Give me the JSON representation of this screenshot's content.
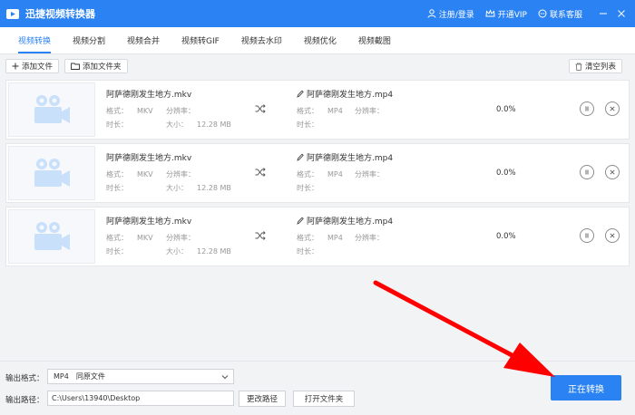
{
  "app": {
    "title": "迅捷视频转换器"
  },
  "header": {
    "login": "注册/登录",
    "vip": "开通VIP",
    "service": "联系客服"
  },
  "tabs": [
    "视频转换",
    "视频分割",
    "视频合并",
    "视频转GIF",
    "视频去水印",
    "视频优化",
    "视频截图"
  ],
  "toolbar": {
    "add_file": "添加文件",
    "add_folder": "添加文件夹",
    "clear": "清空列表"
  },
  "labels": {
    "format": "格式：",
    "resolution": "分辨率：",
    "duration": "时长：",
    "size": "大小："
  },
  "files": [
    {
      "src_name": "阿萨德刚发生地方.mkv",
      "src_format": "MKV",
      "src_size": "12.28 MB",
      "dst_name": "阿萨德刚发生地方.mp4",
      "dst_format": "MP4",
      "progress": "0.0%"
    },
    {
      "src_name": "阿萨德刚发生地方.mkv",
      "src_format": "MKV",
      "src_size": "12.28 MB",
      "dst_name": "阿萨德刚发生地方.mp4",
      "dst_format": "MP4",
      "progress": "0.0%"
    },
    {
      "src_name": "阿萨德刚发生地方.mkv",
      "src_format": "MKV",
      "src_size": "12.28 MB",
      "dst_name": "阿萨德刚发生地方.mp4",
      "dst_format": "MP4",
      "progress": "0.0%"
    }
  ],
  "bottom": {
    "format_label": "输出格式：",
    "format_value": "MP4",
    "format_quality": "同原文件",
    "path_label": "输出路径：",
    "path_value": "C:\\Users\\13940\\Desktop",
    "change_path": "更改路径",
    "open_folder": "打开文件夹",
    "convert": "正在转换"
  },
  "colors": {
    "accent": "#2b82f2",
    "arrow": "#ff0000"
  }
}
